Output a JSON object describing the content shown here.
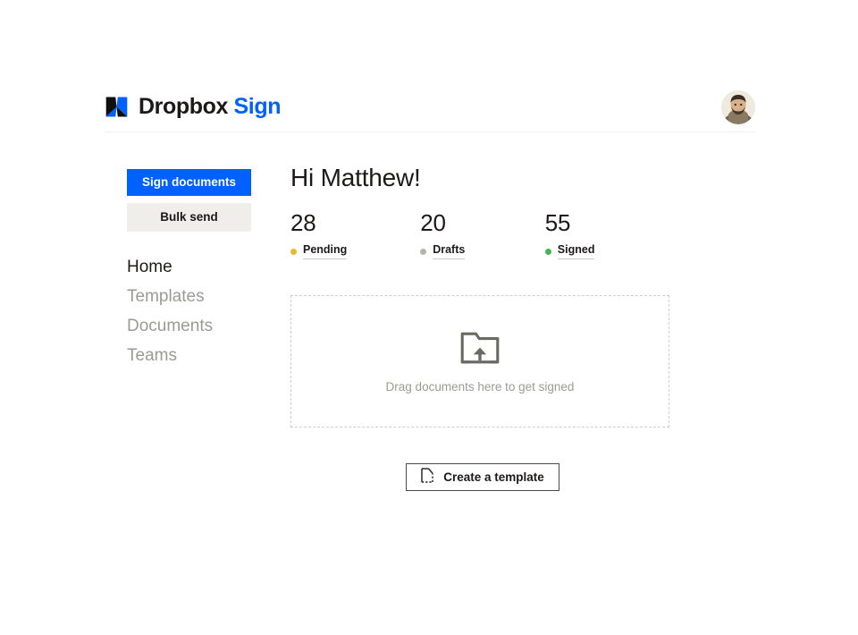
{
  "header": {
    "brand": {
      "mark_icon": "dropbox-x-mark-icon",
      "word_primary": "Dropbox",
      "word_secondary": "Sign"
    },
    "avatar": {
      "icon": "user-avatar",
      "alt": "Account avatar"
    }
  },
  "sidebar": {
    "sign_documents_label": "Sign documents",
    "bulk_send_label": "Bulk send",
    "nav": [
      {
        "label": "Home",
        "active": true
      },
      {
        "label": "Templates",
        "active": false
      },
      {
        "label": "Documents",
        "active": false
      },
      {
        "label": "Teams",
        "active": false
      }
    ]
  },
  "main": {
    "greeting": "Hi Matthew!",
    "stats": [
      {
        "value": "28",
        "label": "Pending",
        "dot_color": "#e8b931"
      },
      {
        "value": "20",
        "label": "Drafts",
        "dot_color": "#b4b4b0"
      },
      {
        "value": "55",
        "label": "Signed",
        "dot_color": "#41b658"
      }
    ],
    "dropzone": {
      "icon": "folder-upload-icon",
      "text": "Drag documents here to get signed"
    },
    "create_template": {
      "icon": "new-document-icon",
      "label": "Create a template"
    }
  },
  "colors": {
    "brand_blue": "#0061fe",
    "ink": "#1e1919",
    "muted": "#9a9a96",
    "surface_gray": "#f0eeeb",
    "border_light": "#cfcfcb"
  }
}
